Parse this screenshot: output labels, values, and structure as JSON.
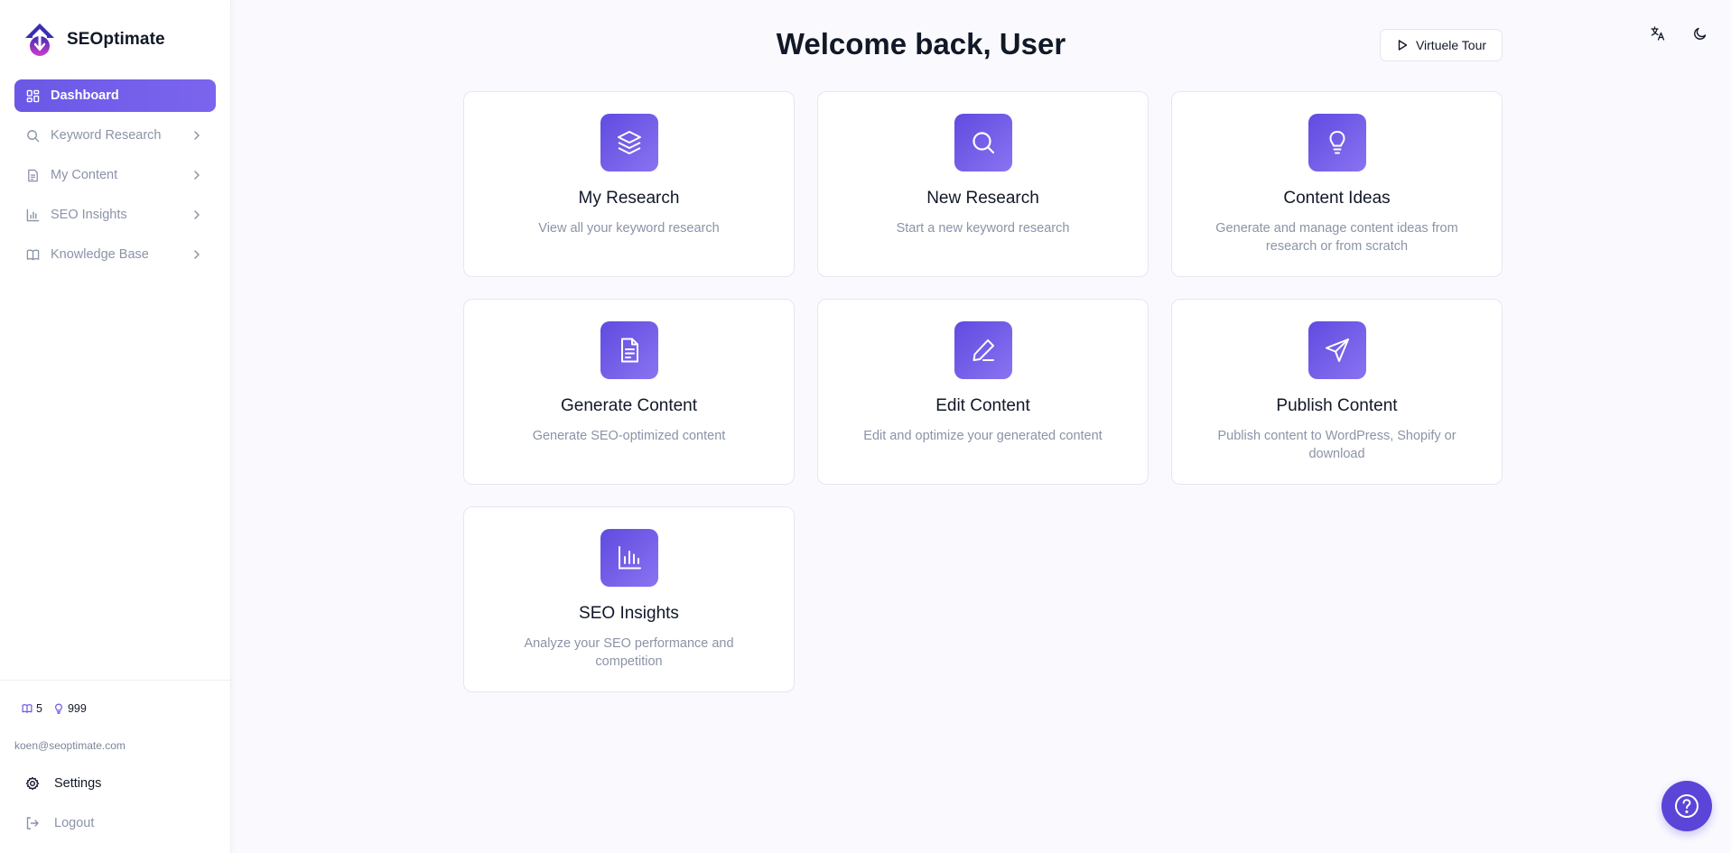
{
  "brand": {
    "name": "SEOptimate"
  },
  "sidebar": {
    "items": [
      {
        "label": "Dashboard",
        "icon": "dashboard-icon",
        "active": true
      },
      {
        "label": "Keyword Research",
        "icon": "search-icon"
      },
      {
        "label": "My Content",
        "icon": "document-icon"
      },
      {
        "label": "SEO Insights",
        "icon": "bar-chart-icon"
      },
      {
        "label": "Knowledge Base",
        "icon": "book-icon"
      }
    ],
    "credits": {
      "research": "5",
      "ideas": "999"
    },
    "email": "koen@seoptimate.com",
    "settings_label": "Settings",
    "logout_label": "Logout"
  },
  "header": {
    "title": "Welcome back, User",
    "tour_label": "Virtuele Tour"
  },
  "cards": [
    {
      "title": "My Research",
      "desc": "View all your keyword research",
      "icon": "layers-icon"
    },
    {
      "title": "New Research",
      "desc": "Start a new keyword research",
      "icon": "search-icon"
    },
    {
      "title": "Content Ideas",
      "desc": "Generate and manage content ideas from research or from scratch",
      "icon": "lightbulb-icon"
    },
    {
      "title": "Generate Content",
      "desc": "Generate SEO-optimized content",
      "icon": "document-icon"
    },
    {
      "title": "Edit Content",
      "desc": "Edit and optimize your generated content",
      "icon": "pen-icon"
    },
    {
      "title": "Publish Content",
      "desc": "Publish content to WordPress, Shopify or download",
      "icon": "send-icon"
    },
    {
      "title": "SEO Insights",
      "desc": "Analyze your SEO performance and competition",
      "icon": "bar-chart-icon"
    }
  ],
  "colors": {
    "accent": "#6a58e6",
    "accent_light": "#8a73f1",
    "muted": "#8b93a7"
  }
}
